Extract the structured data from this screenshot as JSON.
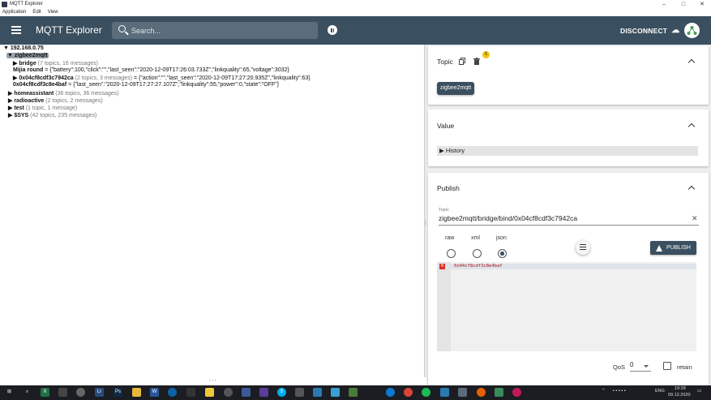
{
  "window": {
    "title": "MQTT Explorer",
    "minimize": "–",
    "maximize": "□",
    "close": "✕"
  },
  "menu": [
    "Application",
    "Edit",
    "View"
  ],
  "appbar": {
    "title": "MQTT Explorer",
    "search_placeholder": "Search...",
    "disconnect_label": "DISCONNECT",
    "cloud_icon": "☁"
  },
  "tree": {
    "root": "▼ 192.168.0.75",
    "zigbee": "▼ zigbee2mqtt",
    "bridge": {
      "name": "▶ bridge",
      "meta": " (7 topics, 16 messages)"
    },
    "mijia": {
      "name": "Mijia round",
      "value": " = {\"battery\":100,\"click\":\"\",\"last_seen\":\"2020-12-09T17:26:03.733Z\",\"linkquality\":65,\"voltage\":3032}"
    },
    "dev1": {
      "name": "▶ 0x04cf8cdf3c7942ca",
      "meta": " (2 topics, 3 messages)",
      "value": " = {\"action\":\"\",\"last_seen\":\"2020-12-09T17:27:20.935Z\",\"linkquality\":63}"
    },
    "dev2": {
      "name": "0x04cf8cdf3c8e4baf",
      "value": " = {\"last_seen\":\"2020-12-09T17:27:27.107Z\",\"linkquality\":55,\"power\":0,\"state\":\"OFF\"}"
    },
    "homeassistant": {
      "name": "▶ homeassistant",
      "meta": " (36 topics, 36 messages)"
    },
    "radioactive": {
      "name": "▶ radioactive",
      "meta": " (2 topics, 2 messages)"
    },
    "test": {
      "name": "▶ test",
      "meta": " (1 topic, 1 message)"
    },
    "sys": {
      "name": "▶ $SYS",
      "meta": " (42 topics, 235 messages)"
    }
  },
  "topic_panel": {
    "title": "Topic",
    "badge": "5",
    "chip": "zigbee2mqtt"
  },
  "value_panel": {
    "title": "Value",
    "history": "▶ History"
  },
  "publish_panel": {
    "title": "Publish",
    "topic_label": "Topic",
    "topic_value": "zigbee2mqtt/bridge/bind/0x04cf8cdf3c7942ca",
    "formats": [
      "raw",
      "xml",
      "json"
    ],
    "selected_format": "json",
    "publish_label": "PUBLISH",
    "code_line": "0x04cf8cdf3c8e4baf",
    "qos_label": "QoS",
    "qos_value": "0",
    "retain_label": "retain"
  },
  "taskbar": {
    "lang": "ENG",
    "time": "19:28",
    "date": "09.12.2020"
  },
  "colors": {
    "appbar": "#3a4f5f",
    "badge": "#f1c40f",
    "error": "#d9342b"
  }
}
